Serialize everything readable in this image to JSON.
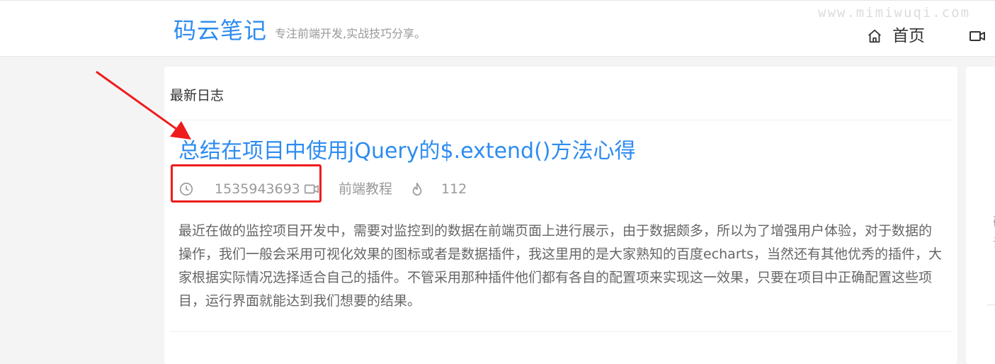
{
  "header": {
    "logo": "码云笔记",
    "tagline": "专注前端开发,实战技巧分享。",
    "watermark": "www.mimiwuqi.com",
    "nav": {
      "home_label": "首页",
      "home_icon": "home-icon",
      "video_icon": "video-icon"
    }
  },
  "main": {
    "section_title": "最新日志",
    "article": {
      "title": "总结在项目中使用jQuery的$.extend()方法心得",
      "meta": {
        "timestamp": "1535943693",
        "category": "前端教程",
        "views": "112",
        "icons": [
          "clock-icon",
          "category-icon",
          "fire-icon"
        ]
      },
      "excerpt": "最近在做的监控项目开发中，需要对监控到的数据在前端页面上进行展示，由于数据颇多，所以为了增强用户体验，对于数据的操作，我们一般会采用可视化效果的图标或者是数据插件，我这里用的是大家熟知的百度echarts，当然还有其他优秀的插件，大家根据实际情况选择适合自己的插件。不管采用那种插件他们都有各自的配置项来实现这一效果，只要在项目中正确配置这些项目，运行界面就能达到我们想要的结果。"
    }
  },
  "sidebar_peek": {
    "chars": [
      "确",
      "说"
    ]
  },
  "annotation": {
    "color": "#ee1c1c"
  },
  "colors": {
    "accent": "#2d8cf0",
    "muted": "#999999",
    "annotation": "#ee1c1c"
  }
}
